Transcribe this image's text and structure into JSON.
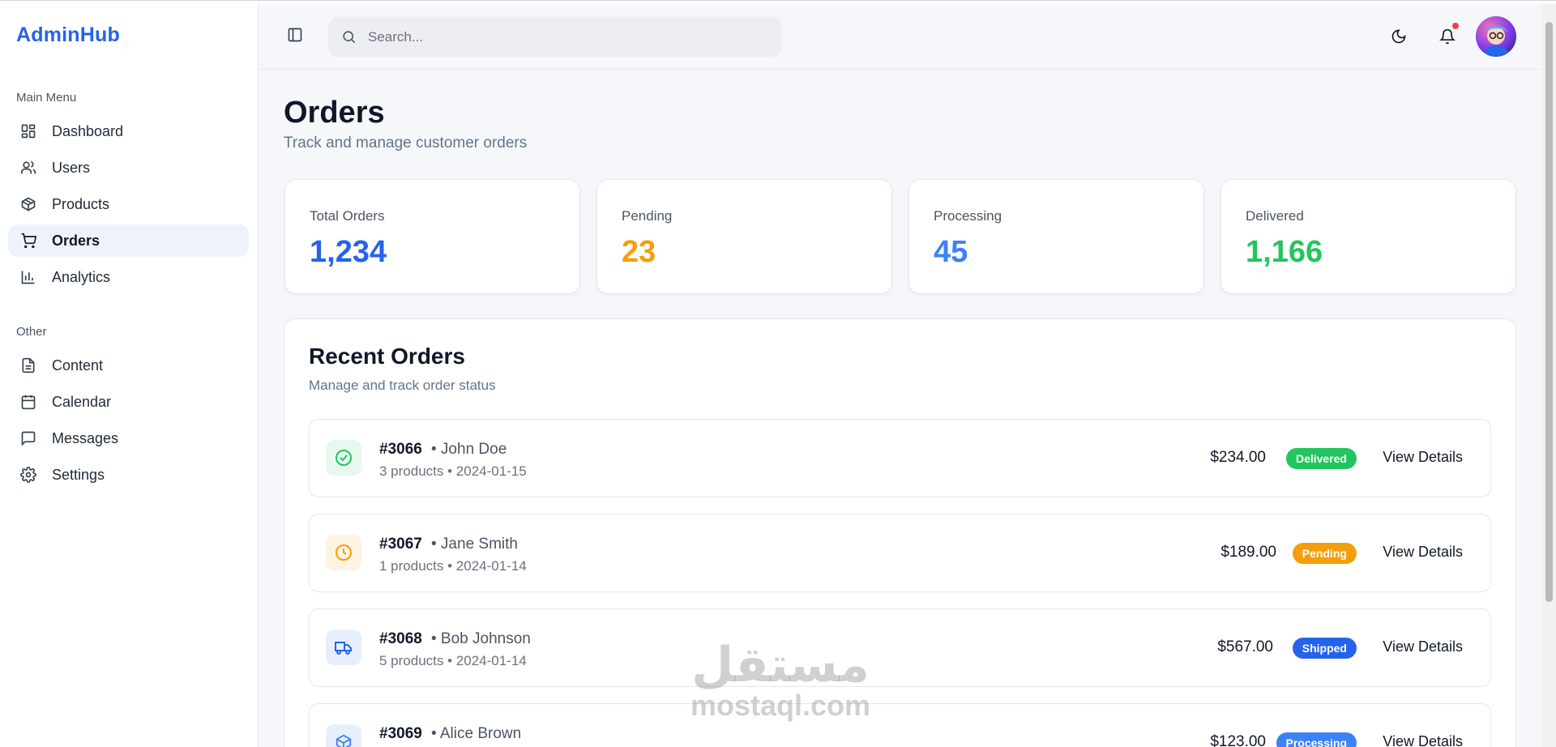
{
  "app": {
    "brand": "AdminHub"
  },
  "sidebar": {
    "main_label": "Main Menu",
    "main_items": [
      {
        "label": "Dashboard",
        "icon": "dashboard-icon"
      },
      {
        "label": "Users",
        "icon": "users-icon"
      },
      {
        "label": "Products",
        "icon": "package-icon"
      },
      {
        "label": "Orders",
        "icon": "cart-icon",
        "active": true
      },
      {
        "label": "Analytics",
        "icon": "bar-chart-icon"
      }
    ],
    "other_label": "Other",
    "other_items": [
      {
        "label": "Content",
        "icon": "file-icon"
      },
      {
        "label": "Calendar",
        "icon": "calendar-icon"
      },
      {
        "label": "Messages",
        "icon": "message-icon"
      },
      {
        "label": "Settings",
        "icon": "gear-icon"
      }
    ]
  },
  "header": {
    "search_placeholder": "Search...",
    "icons": [
      "sidebar-toggle-icon",
      "search-icon",
      "moon-icon",
      "bell-icon",
      "avatar"
    ]
  },
  "page": {
    "title": "Orders",
    "subtitle": "Track and manage customer orders"
  },
  "stats": [
    {
      "label": "Total Orders",
      "value": "1,234",
      "color": "#2563eb"
    },
    {
      "label": "Pending",
      "value": "23",
      "color": "#f59e0b"
    },
    {
      "label": "Processing",
      "value": "45",
      "color": "#3b82f6"
    },
    {
      "label": "Delivered",
      "value": "1,166",
      "color": "#22c55e"
    }
  ],
  "recent": {
    "title": "Recent Orders",
    "subtitle": "Manage and track order status",
    "view_label": "View Details",
    "orders": [
      {
        "id": "#3066",
        "customer": "• John Doe",
        "meta": "3 products • 2024-01-15",
        "amount": "$234.00",
        "status": "Delivered",
        "status_color": "#22c55e",
        "icon": "check-circle-icon",
        "icon_bg": "#e8f8ee",
        "icon_color": "#22c55e"
      },
      {
        "id": "#3067",
        "customer": "• Jane Smith",
        "meta": "1 products • 2024-01-14",
        "amount": "$189.00",
        "status": "Pending",
        "status_color": "#f59e0b",
        "icon": "clock-icon",
        "icon_bg": "#fdf3e2",
        "icon_color": "#f59e0b"
      },
      {
        "id": "#3068",
        "customer": "• Bob Johnson",
        "meta": "5 products • 2024-01-14",
        "amount": "$567.00",
        "status": "Shipped",
        "status_color": "#2563eb",
        "icon": "truck-icon",
        "icon_bg": "#e8effc",
        "icon_color": "#2563eb"
      },
      {
        "id": "#3069",
        "customer": "• Alice Brown",
        "meta": "",
        "amount": "$123.00",
        "status": "Processing",
        "status_color": "#3b82f6",
        "icon": "package-icon",
        "icon_bg": "#e8effc",
        "icon_color": "#3b82f6"
      }
    ]
  },
  "watermark": {
    "line1": "مستقل",
    "line2": "mostaql.com"
  }
}
